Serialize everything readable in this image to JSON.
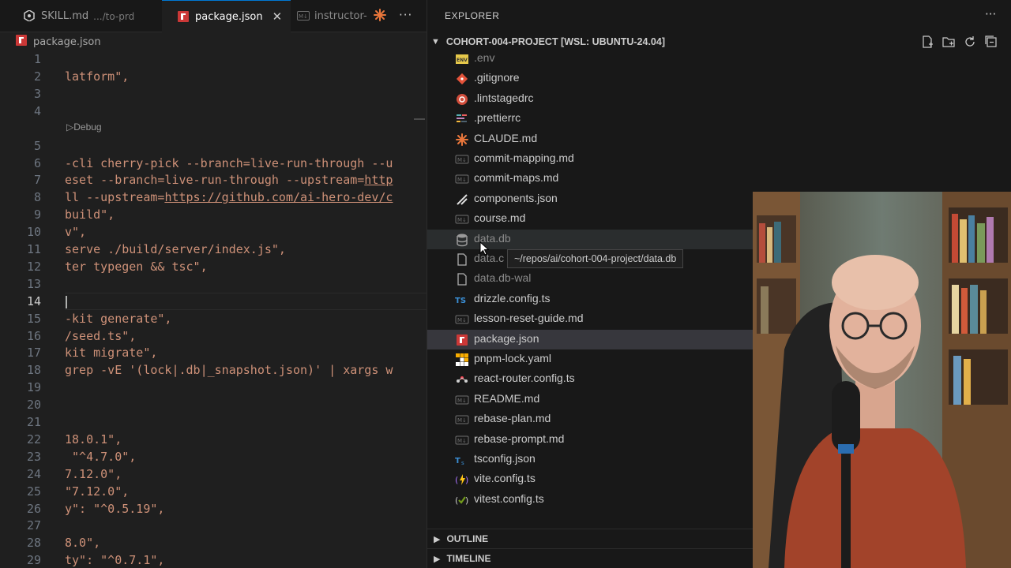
{
  "tabs": [
    {
      "label": "SKILL.md",
      "desc": ".../to-prd",
      "icon": "skill-icon",
      "active": false
    },
    {
      "label": "package.json",
      "desc": "",
      "icon": "npm-icon",
      "active": true,
      "close": "✕"
    },
    {
      "label": "instructor-",
      "desc": "",
      "icon": "markdown-icon",
      "active": false
    }
  ],
  "tab_more": "···",
  "breadcrumb": {
    "file": "package.json"
  },
  "editor": {
    "codelens": "Debug",
    "lines": [
      {
        "n": "1",
        "t": ""
      },
      {
        "n": "2",
        "t": "latform\","
      },
      {
        "n": "3",
        "t": ""
      },
      {
        "n": "4",
        "t": ""
      },
      {
        "n": "5",
        "t": ""
      },
      {
        "n": "6",
        "t": "-cli cherry-pick --branch=live-run-through --u"
      },
      {
        "n": "7",
        "t": "eset --branch=live-run-through --upstream=",
        "u": "http"
      },
      {
        "n": "8",
        "t": "ll --upstream=",
        "u": "https://github.com/ai-hero-dev/c"
      },
      {
        "n": "9",
        "t": "build\","
      },
      {
        "n": "10",
        "t": "v\","
      },
      {
        "n": "11",
        "t": "serve ./build/server/index.js\","
      },
      {
        "n": "12",
        "t": "ter typegen && tsc\","
      },
      {
        "n": "13",
        "t": ""
      },
      {
        "n": "14",
        "t": ""
      },
      {
        "n": "15",
        "t": "-kit generate\","
      },
      {
        "n": "16",
        "t": "/seed.ts\","
      },
      {
        "n": "17",
        "t": "kit migrate\","
      },
      {
        "n": "18",
        "t": "grep -vE '(lock|.db|_snapshot.json)' | xargs w"
      },
      {
        "n": "19",
        "t": ""
      },
      {
        "n": "20",
        "t": ""
      },
      {
        "n": "21",
        "t": ""
      },
      {
        "n": "22",
        "t": "18.0.1\","
      },
      {
        "n": "23",
        "t": " \"^4.7.0\","
      },
      {
        "n": "24",
        "t": "7.12.0\","
      },
      {
        "n": "25",
        "t": "\"7.12.0\","
      },
      {
        "n": "26",
        "t": "y\": \"^0.5.19\","
      },
      {
        "n": "27",
        "t": ""
      },
      {
        "n": "28",
        "t": "8.0\","
      },
      {
        "n": "29",
        "t": "ty\": \"^0.7.1\","
      }
    ]
  },
  "explorer": {
    "title": "EXPLORER",
    "more": "···",
    "project": "COHORT-004-PROJECT [WSL: UBUNTU-24.04]",
    "files": [
      {
        "name": ".env",
        "icon": "env-icon",
        "state": "dim"
      },
      {
        "name": ".gitignore",
        "icon": "git-icon",
        "state": ""
      },
      {
        "name": ".lintstagedrc",
        "icon": "lintstaged-icon",
        "state": ""
      },
      {
        "name": ".prettierrc",
        "icon": "prettier-icon",
        "state": ""
      },
      {
        "name": "CLAUDE.md",
        "icon": "claude-icon",
        "state": ""
      },
      {
        "name": "commit-mapping.md",
        "icon": "markdown-icon",
        "state": ""
      },
      {
        "name": "commit-maps.md",
        "icon": "markdown-icon",
        "state": ""
      },
      {
        "name": "components.json",
        "icon": "shadcn-icon",
        "state": ""
      },
      {
        "name": "course.md",
        "icon": "markdown-icon",
        "state": ""
      },
      {
        "name": "data.db",
        "icon": "database-icon",
        "state": "dim hover"
      },
      {
        "name": "data.c",
        "icon": "file-icon",
        "state": "dim"
      },
      {
        "name": "data.db-wal",
        "icon": "file-icon",
        "state": "dim"
      },
      {
        "name": "drizzle.config.ts",
        "icon": "typescript-icon",
        "state": ""
      },
      {
        "name": "lesson-reset-guide.md",
        "icon": "markdown-icon",
        "state": ""
      },
      {
        "name": "package.json",
        "icon": "npm-icon",
        "state": "selected"
      },
      {
        "name": "pnpm-lock.yaml",
        "icon": "pnpm-icon",
        "state": ""
      },
      {
        "name": "react-router.config.ts",
        "icon": "react-router-icon",
        "state": ""
      },
      {
        "name": "README.md",
        "icon": "markdown-icon",
        "state": ""
      },
      {
        "name": "rebase-plan.md",
        "icon": "markdown-icon",
        "state": ""
      },
      {
        "name": "rebase-prompt.md",
        "icon": "markdown-icon",
        "state": ""
      },
      {
        "name": "tsconfig.json",
        "icon": "tsconfig-icon",
        "state": ""
      },
      {
        "name": "vite.config.ts",
        "icon": "vite-icon",
        "state": ""
      },
      {
        "name": "vitest.config.ts",
        "icon": "vitest-icon",
        "state": ""
      }
    ],
    "tooltip": "~/repos/ai/cohort-004-project/data.db",
    "sections": [
      "OUTLINE",
      "TIMELINE"
    ]
  }
}
